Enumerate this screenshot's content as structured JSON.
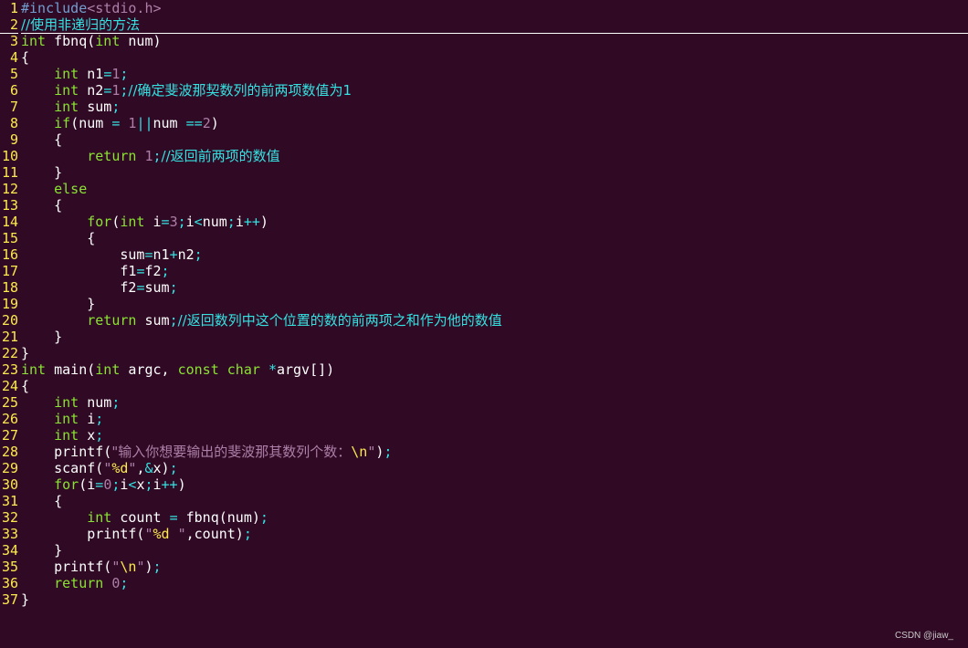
{
  "editor": {
    "colors": {
      "background": "#300a24",
      "line_number": "#fce94f",
      "keyword": "#8ae234",
      "number": "#ad7fa8",
      "operator": "#34e2e2",
      "string": "#ad7fa8",
      "comment": "#34e2e2",
      "preprocessor": "#729fcf",
      "plain": "#ffffff"
    },
    "cursor_line": 2,
    "lines": [
      {
        "n": "1",
        "tokens": [
          {
            "t": "pre",
            "v": "#include"
          },
          {
            "t": "incl",
            "v": "<stdio.h>"
          }
        ]
      },
      {
        "n": "2",
        "tokens": [
          {
            "t": "cmt",
            "v": "//使用非递归的方法"
          }
        ]
      },
      {
        "n": "3",
        "tokens": [
          {
            "t": "type",
            "v": "int"
          },
          {
            "t": "plain",
            "v": " fbnq("
          },
          {
            "t": "type",
            "v": "int"
          },
          {
            "t": "plain",
            "v": " num)"
          }
        ]
      },
      {
        "n": "4",
        "tokens": [
          {
            "t": "plain",
            "v": "{"
          }
        ]
      },
      {
        "n": "5",
        "tokens": [
          {
            "t": "plain",
            "v": "    "
          },
          {
            "t": "type",
            "v": "int"
          },
          {
            "t": "plain",
            "v": " n1"
          },
          {
            "t": "op",
            "v": "="
          },
          {
            "t": "num",
            "v": "1"
          },
          {
            "t": "op",
            "v": ";"
          }
        ]
      },
      {
        "n": "6",
        "tokens": [
          {
            "t": "plain",
            "v": "    "
          },
          {
            "t": "type",
            "v": "int"
          },
          {
            "t": "plain",
            "v": " n2"
          },
          {
            "t": "op",
            "v": "="
          },
          {
            "t": "num",
            "v": "1"
          },
          {
            "t": "op",
            "v": ";"
          },
          {
            "t": "cmt",
            "v": "//确定斐波那契数列的前两项数值为1"
          }
        ]
      },
      {
        "n": "7",
        "tokens": [
          {
            "t": "plain",
            "v": "    "
          },
          {
            "t": "type",
            "v": "int"
          },
          {
            "t": "plain",
            "v": " sum"
          },
          {
            "t": "op",
            "v": ";"
          }
        ]
      },
      {
        "n": "8",
        "tokens": [
          {
            "t": "plain",
            "v": "    "
          },
          {
            "t": "kw",
            "v": "if"
          },
          {
            "t": "plain",
            "v": "(num "
          },
          {
            "t": "op",
            "v": "="
          },
          {
            "t": "plain",
            "v": " "
          },
          {
            "t": "num",
            "v": "1"
          },
          {
            "t": "op",
            "v": "||"
          },
          {
            "t": "plain",
            "v": "num "
          },
          {
            "t": "op",
            "v": "=="
          },
          {
            "t": "num",
            "v": "2"
          },
          {
            "t": "plain",
            "v": ")"
          }
        ]
      },
      {
        "n": "9",
        "tokens": [
          {
            "t": "plain",
            "v": "    {"
          }
        ]
      },
      {
        "n": "10",
        "tokens": [
          {
            "t": "plain",
            "v": "        "
          },
          {
            "t": "kw",
            "v": "return"
          },
          {
            "t": "plain",
            "v": " "
          },
          {
            "t": "num",
            "v": "1"
          },
          {
            "t": "op",
            "v": ";"
          },
          {
            "t": "cmt",
            "v": "//返回前两项的数值"
          }
        ]
      },
      {
        "n": "11",
        "tokens": [
          {
            "t": "plain",
            "v": "    }"
          }
        ]
      },
      {
        "n": "12",
        "tokens": [
          {
            "t": "plain",
            "v": "    "
          },
          {
            "t": "kw",
            "v": "else"
          }
        ]
      },
      {
        "n": "13",
        "tokens": [
          {
            "t": "plain",
            "v": "    {"
          }
        ]
      },
      {
        "n": "14",
        "tokens": [
          {
            "t": "plain",
            "v": "        "
          },
          {
            "t": "kw",
            "v": "for"
          },
          {
            "t": "plain",
            "v": "("
          },
          {
            "t": "type",
            "v": "int"
          },
          {
            "t": "plain",
            "v": " i"
          },
          {
            "t": "op",
            "v": "="
          },
          {
            "t": "num",
            "v": "3"
          },
          {
            "t": "op",
            "v": ";"
          },
          {
            "t": "plain",
            "v": "i"
          },
          {
            "t": "op",
            "v": "<"
          },
          {
            "t": "plain",
            "v": "num"
          },
          {
            "t": "op",
            "v": ";"
          },
          {
            "t": "plain",
            "v": "i"
          },
          {
            "t": "op",
            "v": "++"
          },
          {
            "t": "plain",
            "v": ")"
          }
        ]
      },
      {
        "n": "15",
        "tokens": [
          {
            "t": "plain",
            "v": "        {"
          }
        ]
      },
      {
        "n": "16",
        "tokens": [
          {
            "t": "plain",
            "v": "            sum"
          },
          {
            "t": "op",
            "v": "="
          },
          {
            "t": "plain",
            "v": "n1"
          },
          {
            "t": "op",
            "v": "+"
          },
          {
            "t": "plain",
            "v": "n2"
          },
          {
            "t": "op",
            "v": ";"
          }
        ]
      },
      {
        "n": "17",
        "tokens": [
          {
            "t": "plain",
            "v": "            f1"
          },
          {
            "t": "op",
            "v": "="
          },
          {
            "t": "plain",
            "v": "f2"
          },
          {
            "t": "op",
            "v": ";"
          }
        ]
      },
      {
        "n": "18",
        "tokens": [
          {
            "t": "plain",
            "v": "            f2"
          },
          {
            "t": "op",
            "v": "="
          },
          {
            "t": "plain",
            "v": "sum"
          },
          {
            "t": "op",
            "v": ";"
          }
        ]
      },
      {
        "n": "19",
        "tokens": [
          {
            "t": "plain",
            "v": "        }"
          }
        ]
      },
      {
        "n": "20",
        "tokens": [
          {
            "t": "plain",
            "v": "        "
          },
          {
            "t": "kw",
            "v": "return"
          },
          {
            "t": "plain",
            "v": " sum"
          },
          {
            "t": "op",
            "v": ";"
          },
          {
            "t": "cmt",
            "v": "//返回数列中这个位置的数的前两项之和作为他的数值"
          }
        ]
      },
      {
        "n": "21",
        "tokens": [
          {
            "t": "plain",
            "v": "    }"
          }
        ]
      },
      {
        "n": "22",
        "tokens": [
          {
            "t": "plain",
            "v": "}"
          }
        ]
      },
      {
        "n": "23",
        "tokens": [
          {
            "t": "type",
            "v": "int"
          },
          {
            "t": "plain",
            "v": " main("
          },
          {
            "t": "type",
            "v": "int"
          },
          {
            "t": "plain",
            "v": " argc, "
          },
          {
            "t": "type",
            "v": "const"
          },
          {
            "t": "plain",
            "v": " "
          },
          {
            "t": "type",
            "v": "char"
          },
          {
            "t": "plain",
            "v": " "
          },
          {
            "t": "op",
            "v": "*"
          },
          {
            "t": "plain",
            "v": "argv[])"
          }
        ]
      },
      {
        "n": "24",
        "tokens": [
          {
            "t": "plain",
            "v": "{"
          }
        ]
      },
      {
        "n": "25",
        "tokens": [
          {
            "t": "plain",
            "v": "    "
          },
          {
            "t": "type",
            "v": "int"
          },
          {
            "t": "plain",
            "v": " num"
          },
          {
            "t": "op",
            "v": ";"
          }
        ]
      },
      {
        "n": "26",
        "tokens": [
          {
            "t": "plain",
            "v": "    "
          },
          {
            "t": "type",
            "v": "int"
          },
          {
            "t": "plain",
            "v": " i"
          },
          {
            "t": "op",
            "v": ";"
          }
        ]
      },
      {
        "n": "27",
        "tokens": [
          {
            "t": "plain",
            "v": "    "
          },
          {
            "t": "type",
            "v": "int"
          },
          {
            "t": "plain",
            "v": " x"
          },
          {
            "t": "op",
            "v": ";"
          }
        ]
      },
      {
        "n": "28",
        "tokens": [
          {
            "t": "plain",
            "v": "    printf("
          },
          {
            "t": "str",
            "v": "\"输入你想要输出的斐波那其数列个数："
          },
          {
            "t": "esc",
            "v": "\\n"
          },
          {
            "t": "str",
            "v": "\""
          },
          {
            "t": "plain",
            "v": ")"
          },
          {
            "t": "op",
            "v": ";"
          }
        ]
      },
      {
        "n": "29",
        "tokens": [
          {
            "t": "plain",
            "v": "    scanf("
          },
          {
            "t": "str",
            "v": "\""
          },
          {
            "t": "esc",
            "v": "%d"
          },
          {
            "t": "str",
            "v": "\""
          },
          {
            "t": "plain",
            "v": ","
          },
          {
            "t": "op",
            "v": "&"
          },
          {
            "t": "plain",
            "v": "x)"
          },
          {
            "t": "op",
            "v": ";"
          }
        ]
      },
      {
        "n": "30",
        "tokens": [
          {
            "t": "plain",
            "v": "    "
          },
          {
            "t": "kw",
            "v": "for"
          },
          {
            "t": "plain",
            "v": "(i"
          },
          {
            "t": "op",
            "v": "="
          },
          {
            "t": "num",
            "v": "0"
          },
          {
            "t": "op",
            "v": ";"
          },
          {
            "t": "plain",
            "v": "i"
          },
          {
            "t": "op",
            "v": "<"
          },
          {
            "t": "plain",
            "v": "x"
          },
          {
            "t": "op",
            "v": ";"
          },
          {
            "t": "plain",
            "v": "i"
          },
          {
            "t": "op",
            "v": "++"
          },
          {
            "t": "plain",
            "v": ")"
          }
        ]
      },
      {
        "n": "31",
        "tokens": [
          {
            "t": "plain",
            "v": "    {"
          }
        ]
      },
      {
        "n": "32",
        "tokens": [
          {
            "t": "plain",
            "v": "        "
          },
          {
            "t": "type",
            "v": "int"
          },
          {
            "t": "plain",
            "v": " count "
          },
          {
            "t": "op",
            "v": "="
          },
          {
            "t": "plain",
            "v": " fbnq(num)"
          },
          {
            "t": "op",
            "v": ";"
          }
        ]
      },
      {
        "n": "33",
        "tokens": [
          {
            "t": "plain",
            "v": "        printf("
          },
          {
            "t": "str",
            "v": "\""
          },
          {
            "t": "esc",
            "v": "%d"
          },
          {
            "t": "str",
            "v": " \""
          },
          {
            "t": "plain",
            "v": ",count)"
          },
          {
            "t": "op",
            "v": ";"
          }
        ]
      },
      {
        "n": "34",
        "tokens": [
          {
            "t": "plain",
            "v": "    }"
          }
        ]
      },
      {
        "n": "35",
        "tokens": [
          {
            "t": "plain",
            "v": "    printf("
          },
          {
            "t": "str",
            "v": "\""
          },
          {
            "t": "esc",
            "v": "\\n"
          },
          {
            "t": "str",
            "v": "\""
          },
          {
            "t": "plain",
            "v": ")"
          },
          {
            "t": "op",
            "v": ";"
          }
        ]
      },
      {
        "n": "36",
        "tokens": [
          {
            "t": "plain",
            "v": "    "
          },
          {
            "t": "kw",
            "v": "return"
          },
          {
            "t": "plain",
            "v": " "
          },
          {
            "t": "num",
            "v": "0"
          },
          {
            "t": "op",
            "v": ";"
          }
        ]
      },
      {
        "n": "37",
        "tokens": [
          {
            "t": "plain",
            "v": "}"
          }
        ]
      }
    ]
  },
  "watermark": {
    "text": "CSDN @jiaw_"
  }
}
